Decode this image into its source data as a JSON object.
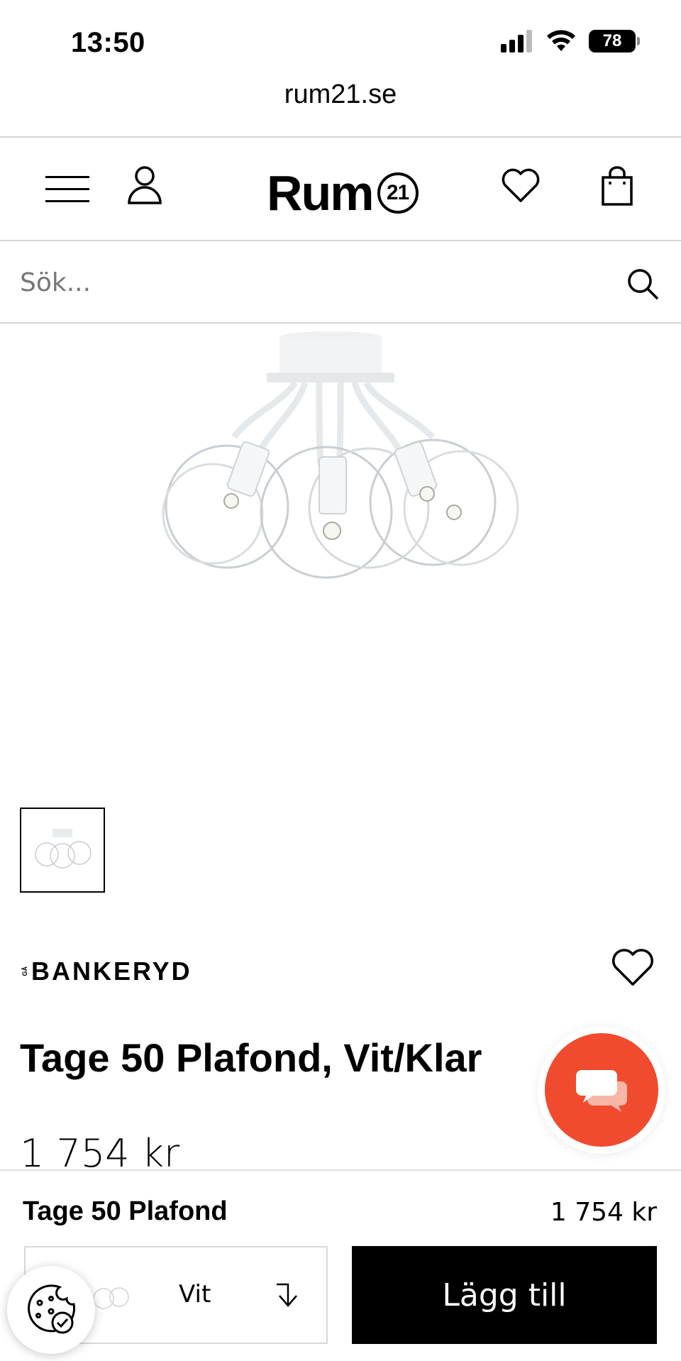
{
  "status_bar": {
    "time": "13:50",
    "battery": "78"
  },
  "browser": {
    "url": "rum21.se"
  },
  "header": {
    "logo_text": "Rum",
    "logo_number": "21"
  },
  "search": {
    "placeholder": "Sök..."
  },
  "product": {
    "brand": "BANKERYD",
    "brand_prefix": "GÅ",
    "title": "Tage 50 Plafond, Vit/Klar",
    "price": "1 754 kr"
  },
  "sticky_bar": {
    "name": "Tage 50 Plafond",
    "price": "1 754 kr",
    "variant": "Vit",
    "add_button": "Lägg till"
  },
  "colors": {
    "accent_chat": "#f04b2e",
    "button_bg": "#000000"
  }
}
